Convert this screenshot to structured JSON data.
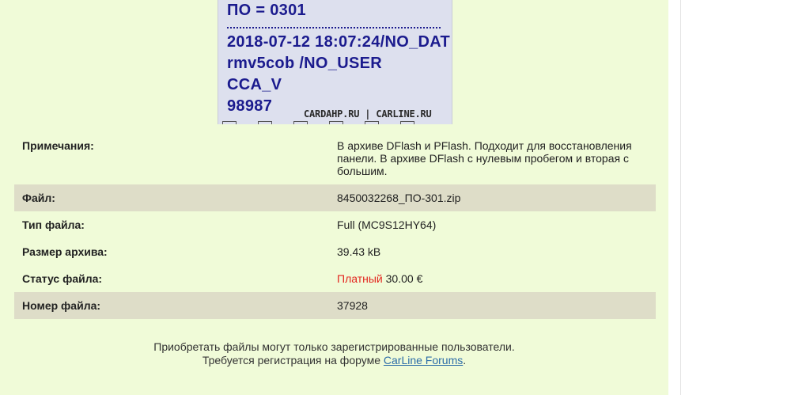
{
  "photo": {
    "lines": [
      "ПО = 0301",
      "2018-07-12 18:07:24/NO_DAT",
      "rmv5cob /NO_USER",
      "CCA_V",
      "98987"
    ],
    "watermark": "CARDAHP.RU | CARLINE.RU"
  },
  "details": {
    "notes_label": "Примечания:",
    "notes_value": "В архиве DFlash и PFlash. Подходит для восстановления панели. В архиве DFlash с нулевым пробегом и вторая с большим.",
    "file_label": "Файл:",
    "file_value": "8450032268_ПО-301.zip",
    "type_label": "Тип файла:",
    "type_value": "Full (MC9S12HY64)",
    "size_label": "Размер архива:",
    "size_value": "39.43 kB",
    "status_label": "Статус файла:",
    "status_paid": "Платный",
    "status_price": "30.00 €",
    "number_label": "Номер файла:",
    "number_value": "37928"
  },
  "notice": {
    "line1": "Приобретать файлы могут только зарегистрированные пользователи.",
    "line2_prefix": "Требуется регистрация на форуме",
    "link_text": "CarLine Forums",
    "line2_suffix": "."
  },
  "colors": {
    "page_bg": "#f0fbd8",
    "shaded_row": "#deddc8",
    "paid_status": "#e3261f",
    "link": "#2b6ca8"
  }
}
